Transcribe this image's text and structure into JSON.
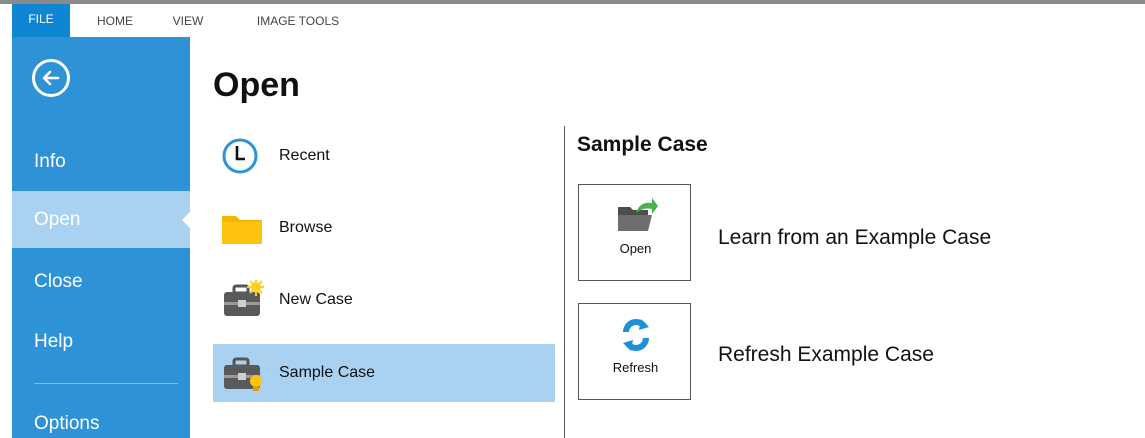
{
  "ribbon": {
    "tabs": [
      "FILE",
      "HOME",
      "VIEW",
      "IMAGE TOOLS"
    ]
  },
  "nav": {
    "back_icon": "arrow-left-icon",
    "items": [
      "Info",
      "Open",
      "Close",
      "Help",
      "Options"
    ],
    "active": "Open"
  },
  "page": {
    "title": "Open"
  },
  "open_options": [
    {
      "label": "Recent",
      "icon": "clock-icon"
    },
    {
      "label": "Browse",
      "icon": "folder-icon"
    },
    {
      "label": "New Case",
      "icon": "new-case-icon"
    },
    {
      "label": "Sample Case",
      "icon": "sample-case-icon",
      "selected": true
    }
  ],
  "detail": {
    "title": "Sample Case",
    "actions": [
      {
        "button_label": "Open",
        "description": "Learn from an Example Case",
        "icon": "open-folder-icon"
      },
      {
        "button_label": "Refresh",
        "description": "Refresh Example Case",
        "icon": "refresh-icon"
      }
    ]
  },
  "colors": {
    "accent": "#0e86d4",
    "nav_bg": "#2d93d6",
    "selection": "#a9d1f2"
  }
}
